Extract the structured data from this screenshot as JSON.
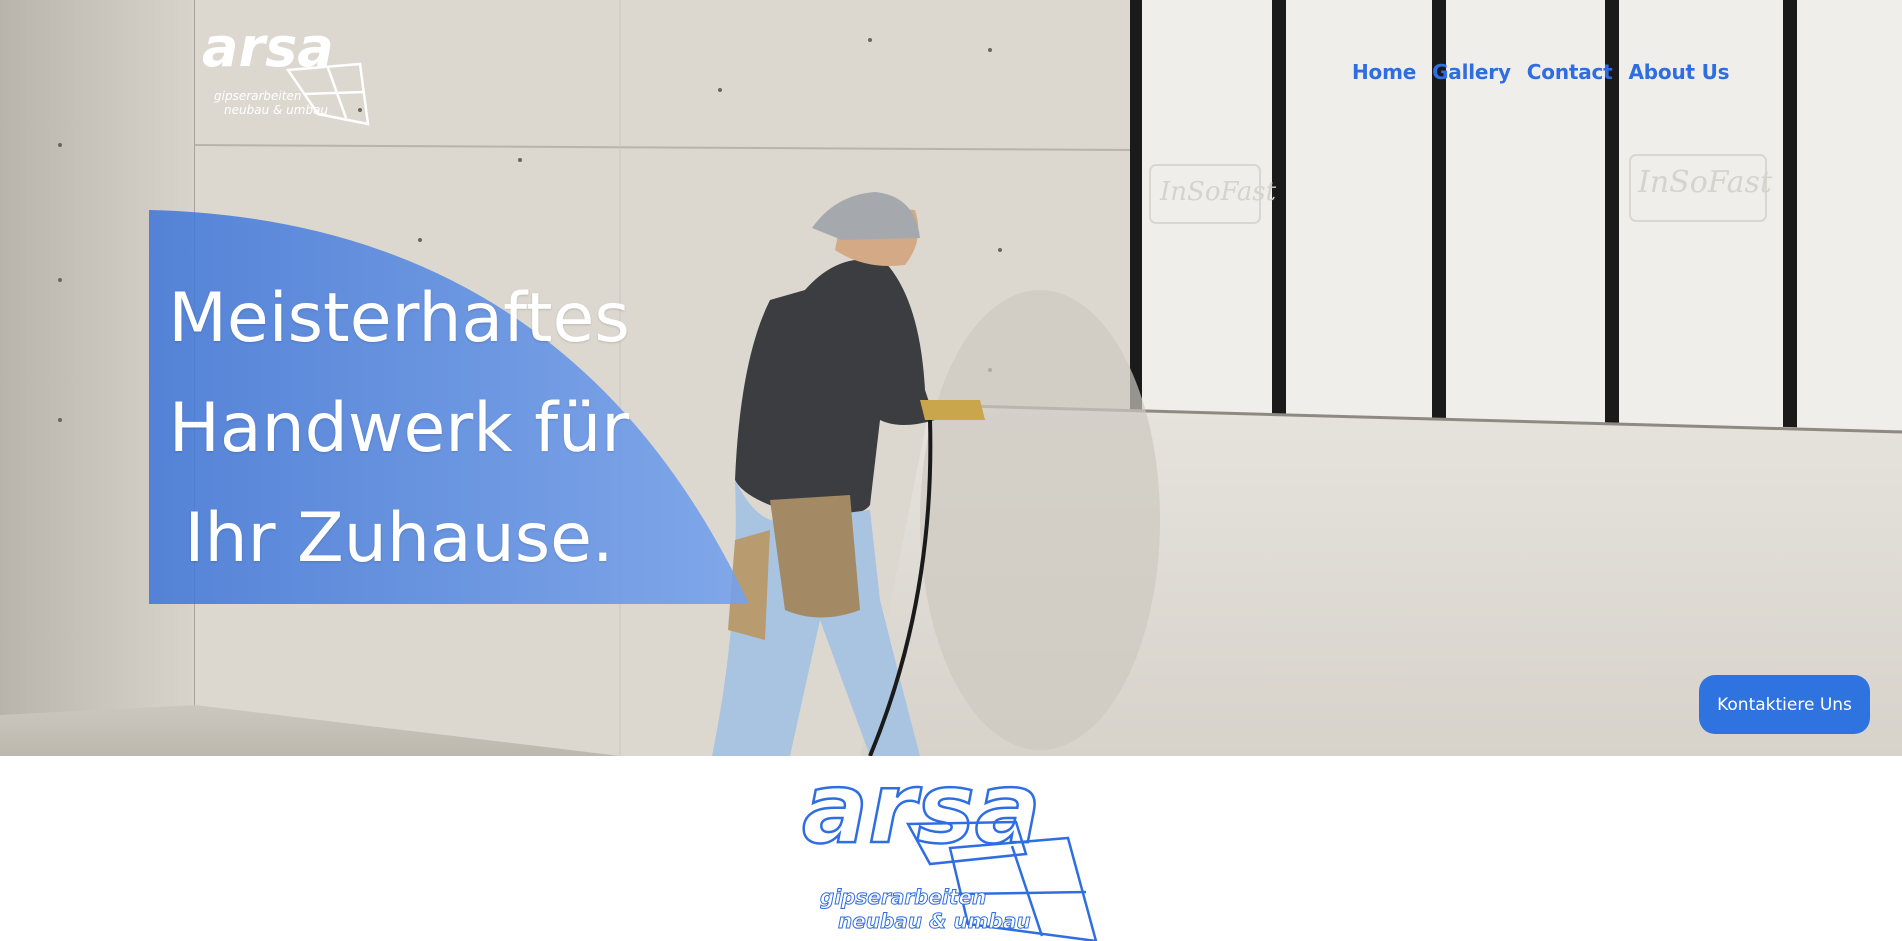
{
  "brand": {
    "name": "arsa",
    "tagline_line1": "gipserarbeiten",
    "tagline_line2": "neubau & umbau",
    "color": "#2f6ee0"
  },
  "nav": {
    "items": [
      {
        "label": "Home"
      },
      {
        "label": "Gallery"
      },
      {
        "label": "Contact"
      },
      {
        "label": "About Us"
      }
    ]
  },
  "hero": {
    "headline_lines": [
      "Meisterhaftes",
      "Handwerk für",
      "Ihr Zuhause."
    ],
    "cta_label": "Kontaktiere Uns",
    "wall_panel_label": "InSoFast",
    "accent_color": "#5b8ee6"
  }
}
